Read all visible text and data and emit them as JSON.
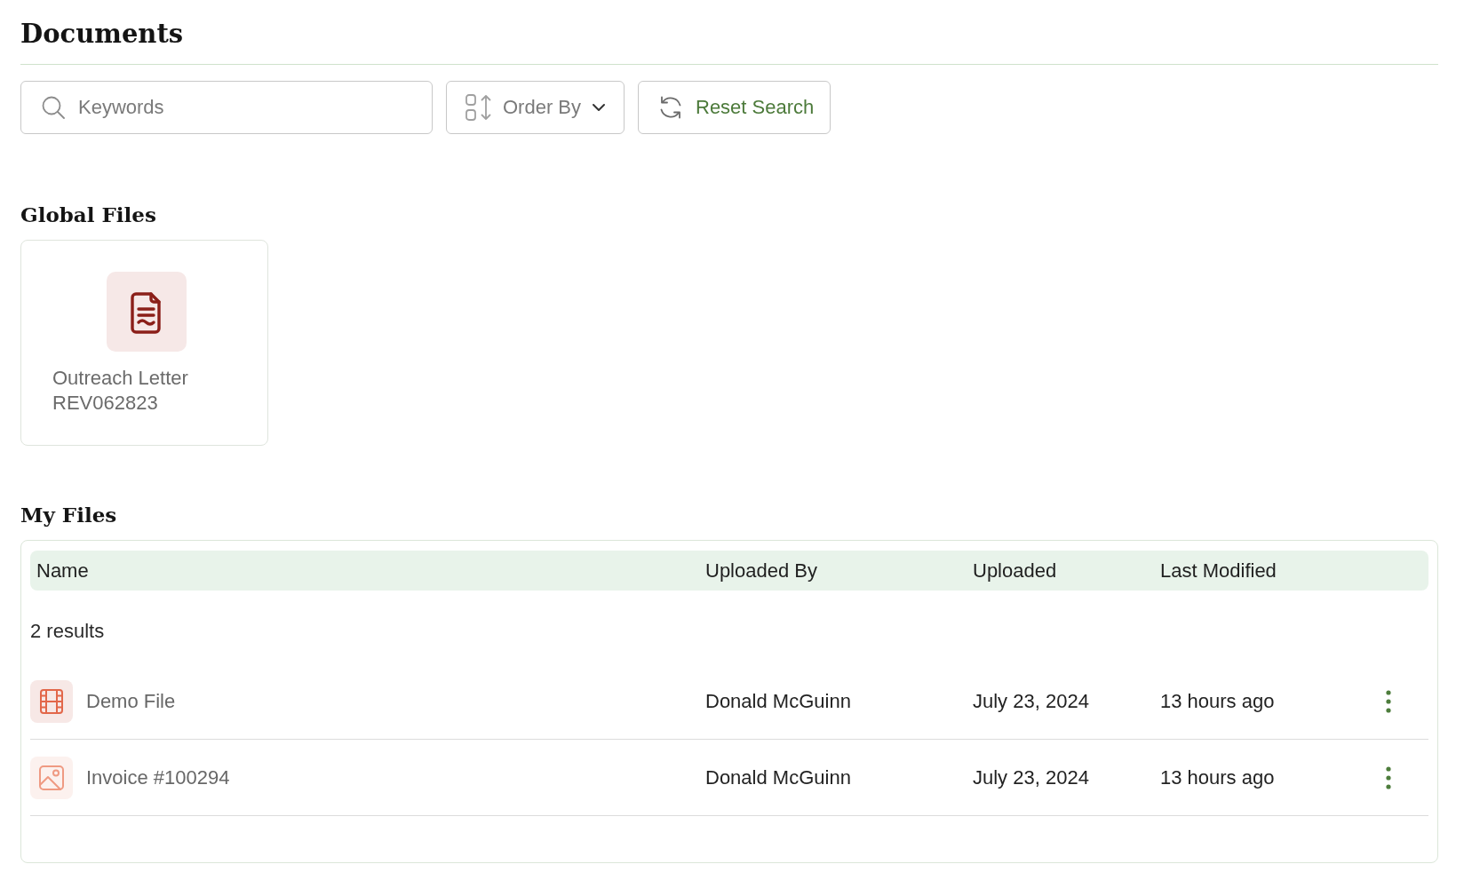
{
  "page_title": "Documents",
  "toolbar": {
    "search": {
      "placeholder": "Keywords"
    },
    "order_by": {
      "label": "Order By"
    },
    "reset_search": {
      "label": "Reset Search"
    }
  },
  "global_files": {
    "heading": "Global Files",
    "files": [
      {
        "kind": "document",
        "name": "Outreach Letter REV062823"
      }
    ]
  },
  "my_files": {
    "heading": "My Files",
    "columns": [
      "Name",
      "Uploaded By",
      "Uploaded",
      "Last Modified"
    ],
    "result_count": "2 results",
    "rows": [
      {
        "kind": "video",
        "name": "Demo File",
        "uploaded_by": "Donald McGuinn",
        "uploaded": "July 23, 2024",
        "last_modified": "13 hours ago"
      },
      {
        "kind": "image",
        "name": "Invoice #100294",
        "uploaded_by": "Donald McGuinn",
        "uploaded": "July 23, 2024",
        "last_modified": "13 hours ago"
      }
    ]
  }
}
